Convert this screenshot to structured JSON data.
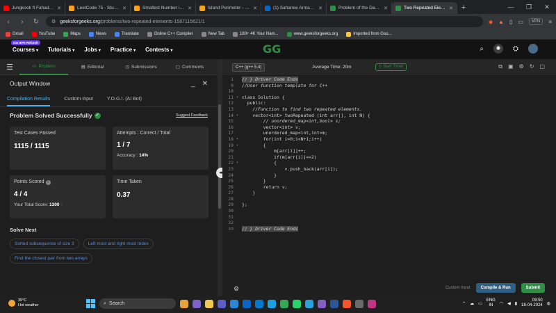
{
  "browser": {
    "tabs": [
      {
        "label": "Jungkook ft Fahad Al Kub",
        "color": "#ff0000"
      },
      {
        "label": "LeetCode 75 - Study Plan",
        "color": "#ffa116"
      },
      {
        "label": "Smallest Number in Infinite",
        "color": "#ffa116"
      },
      {
        "label": "Island Perimeter - LeetCode",
        "color": "#ffa116"
      },
      {
        "label": "(1) Sahanee Arman | Linke",
        "color": "#0a66c2"
      },
      {
        "label": "Problem of the Day | Geek",
        "color": "#2f8d46"
      },
      {
        "label": "Two Repeated Eleme",
        "color": "#2f8d46",
        "active": true
      }
    ],
    "url_domain": "geeksforgeeks.org",
    "url_path": "/problems/two-repeated-elements-1587115621/1",
    "vpn": "VPN",
    "bookmarks": [
      {
        "label": "Gmail",
        "color": "#ea4335"
      },
      {
        "label": "YouTube",
        "color": "#ff0000"
      },
      {
        "label": "Maps",
        "color": "#34a853"
      },
      {
        "label": "News",
        "color": "#4285f4"
      },
      {
        "label": "Translate",
        "color": "#4285f4"
      },
      {
        "label": "Online C++ Compiler",
        "color": "#888888"
      },
      {
        "label": "New Tab",
        "color": "#888888"
      },
      {
        "label": "180+ 4K Your Nam...",
        "color": "#888888"
      },
      {
        "label": "www.geeksforgeeks.org",
        "color": "#2f8d46"
      },
      {
        "label": "Imported from Goo...",
        "color": "#f2c94c"
      }
    ]
  },
  "gfg": {
    "offer_badge": "Get 90% Refund!",
    "nav": [
      "Courses",
      "Tutorials",
      "Jobs",
      "Practice",
      "Contests"
    ],
    "logo": "GG"
  },
  "left": {
    "tabs": [
      "Problem",
      "Editorial",
      "Submissions",
      "Comments"
    ],
    "output_title": "Output Window",
    "subtabs": [
      "Compilation Results",
      "Custom Input",
      "Y.O.G.I. (AI Bot)"
    ],
    "status": "Problem Solved Successfully",
    "suggest": "Suggest Feedback",
    "test_label": "Test Cases Passed",
    "test_value": "1115 / 1115",
    "attempts_label": "Attempts : Correct / Total",
    "attempts_value": "1 / 7",
    "accuracy_label": "Accuracy :",
    "accuracy_value": "14%",
    "points_label": "Points Scored",
    "points_value": "4 / 4",
    "total_label": "Your Total Score:",
    "total_value": "1300",
    "time_label": "Time Taken",
    "time_value": "0.37",
    "solve_next": "Solve Next",
    "suggestions": [
      "Sorted subsequence of size 3",
      "Left most and right most index",
      "Find the closest pair from two arrays"
    ]
  },
  "editor": {
    "language": "C++ (g++ 5.4)",
    "avg_time": "Average Time: 20m",
    "timer": "Start Timer",
    "custom_input": "Custom Input",
    "compile": "Compile & Run",
    "submit": "Submit",
    "lines": [
      {
        "n": "1",
        "t": "// } Driver Code Ends",
        "c": "cm"
      },
      {
        "n": "9",
        "t": "//User function template for C++",
        "c": "cm"
      },
      {
        "n": "10",
        "t": ""
      },
      {
        "n": "11",
        "t": "class Solution {"
      },
      {
        "n": "12",
        "t": "  public:"
      },
      {
        "n": "13",
        "t": "    //Function to find two repeated elements.",
        "c": "cm"
      },
      {
        "n": "14",
        "t": "    vector<int> twoRepeated (int arr[], int N) {"
      },
      {
        "n": "15",
        "t": "        // unordered_map<int,bool> s;",
        "c": "cm"
      },
      {
        "n": "16",
        "t": "        vector<int> v;"
      },
      {
        "n": "17",
        "t": "        unordered_map<int,int>m;"
      },
      {
        "n": "18",
        "t": "        for(int i=0;i<N+1;i++)"
      },
      {
        "n": "19",
        "t": "        {"
      },
      {
        "n": "20",
        "t": "            m[arr[i]]++;"
      },
      {
        "n": "21",
        "t": "            if(m[arr[i]]==2)"
      },
      {
        "n": "22",
        "t": "            {"
      },
      {
        "n": "23",
        "t": "                v.push_back(arr[i]);"
      },
      {
        "n": "24",
        "t": "            }"
      },
      {
        "n": "25",
        "t": "        }"
      },
      {
        "n": "26",
        "t": "        return v;"
      },
      {
        "n": "27",
        "t": "    }"
      },
      {
        "n": "28",
        "t": ""
      },
      {
        "n": "29",
        "t": "};"
      },
      {
        "n": "30",
        "t": ""
      },
      {
        "n": "31",
        "t": ""
      },
      {
        "n": "32",
        "t": ""
      },
      {
        "n": "33",
        "t": "// } Driver Code Ends",
        "c": "cm"
      }
    ]
  },
  "taskbar": {
    "temp": "35°C",
    "weather": "Hot weather",
    "search": "Search",
    "lang_top": "ENG",
    "lang_bottom": "IN",
    "time": "09:50",
    "date": "18-04-2024"
  }
}
